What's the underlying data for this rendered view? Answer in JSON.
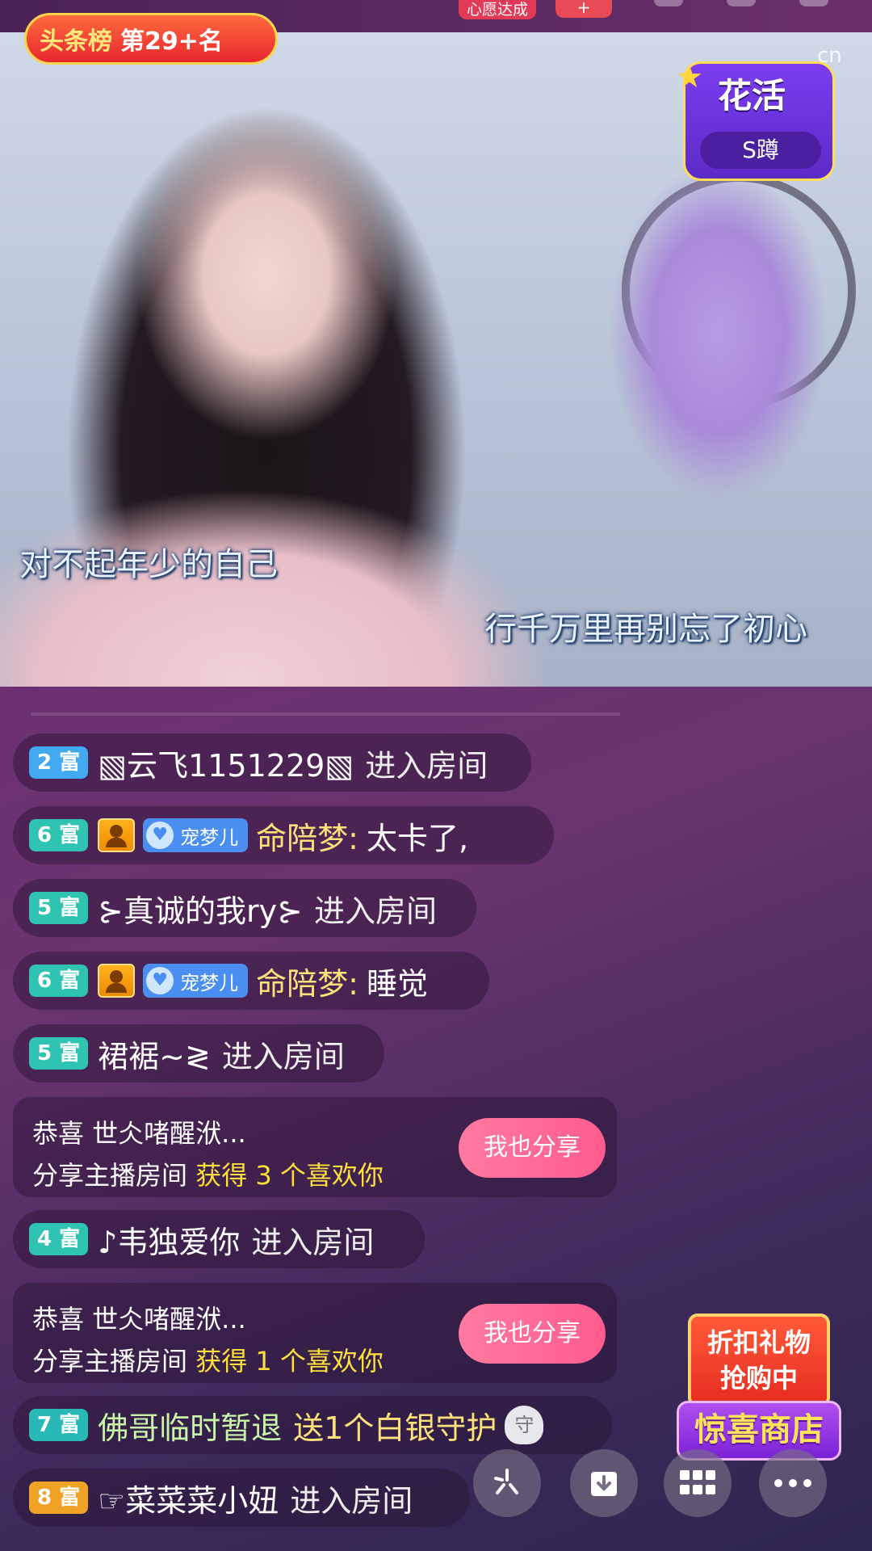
{
  "top": {
    "wish_label": "心愿达成",
    "plus_label": "+"
  },
  "video": {
    "rank_label": "头条榜",
    "rank_value": "第29+名",
    "activity_title": "花活",
    "activity_sub": "S蹲",
    "logo_text": "cn",
    "lyric_1": "对不起年少的自己",
    "lyric_2": "行千万里再别忘了初心"
  },
  "chat": {
    "messages": [
      {
        "level": "2 富",
        "name": "▧云飞1151229▧",
        "text": "进入房间"
      },
      {
        "level": "6 富",
        "pet": "宠梦儿",
        "name": "命陪梦:",
        "text": "太卡了,"
      },
      {
        "level": "5 富",
        "name": "⊱真诚的我ry⊱",
        "text": "进入房间"
      },
      {
        "level": "6 富",
        "pet": "宠梦儿",
        "name": "命陪梦:",
        "text": "睡觉"
      },
      {
        "level": "5 富",
        "name": "裙裾~≷",
        "text": "进入房间"
      },
      {
        "level": "4 富",
        "name": "♪韦独爱你",
        "text": "进入房间"
      },
      {
        "level": "7 富",
        "name": "佛哥临时暂退",
        "text": "送1个白银守护",
        "guard": "守"
      },
      {
        "level": "8 富",
        "name": "☞菜菜菜小妞",
        "text": "进入房间"
      }
    ],
    "shares": [
      {
        "line1": "恭喜 世仌啫醒洑...",
        "prefix": "分享主播房间",
        "reward": "获得 3 个喜欢你",
        "button": "我也分享"
      },
      {
        "line1": "恭喜 世仌啫醒洑...",
        "prefix": "分享主播房间",
        "reward": "获得 1 个喜欢你",
        "button": "我也分享"
      }
    ]
  },
  "promo": {
    "line1": "折扣礼物",
    "line2": "抢购中",
    "shop": "惊喜商店"
  },
  "controls": {
    "effects_icon": "sparkle-icon",
    "download_icon": "download-icon",
    "grid_icon": "grid-icon",
    "more_icon": "more-icon"
  }
}
